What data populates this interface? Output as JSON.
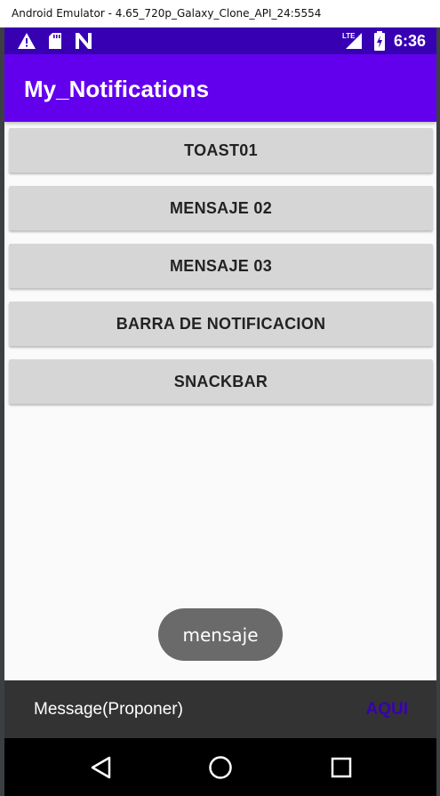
{
  "window": {
    "title": "Android Emulator - 4.65_720p_Galaxy_Clone_API_24:5554"
  },
  "status_bar": {
    "time": "6:36",
    "network_label": "LTE",
    "icons": [
      "warning-icon",
      "sd-card-icon",
      "n-logo-icon",
      "signal-icon",
      "battery-charging-icon"
    ],
    "color": "#3700b3"
  },
  "app_bar": {
    "title": "My_Notifications",
    "color": "#6200ee"
  },
  "buttons": [
    {
      "label": "TOAST01"
    },
    {
      "label": "MENSAJE 02"
    },
    {
      "label": "MENSAJE 03"
    },
    {
      "label": "BARRA DE NOTIFICACION"
    },
    {
      "label": "SNACKBAR"
    }
  ],
  "toast": {
    "text": "mensaje"
  },
  "snackbar": {
    "message": "Message(Proponer)",
    "action": "AQUI",
    "action_color": "#3700b3"
  },
  "nav_bar": {
    "icons": [
      "back-icon",
      "home-icon",
      "recents-icon"
    ]
  }
}
